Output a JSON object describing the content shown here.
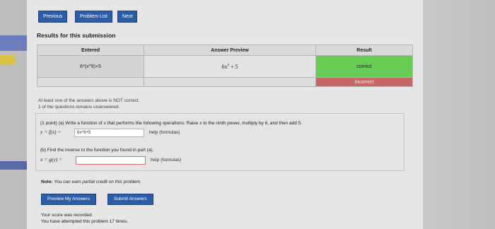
{
  "nav": {
    "previous": "Previous",
    "problem_list": "Problem List",
    "next": "Next"
  },
  "results": {
    "heading": "Results for this submission",
    "headers": [
      "Entered",
      "Answer Preview",
      "Result"
    ],
    "rows": [
      {
        "entered": "6*(x^9)+5",
        "preview_coef": "6x",
        "preview_exp": "9",
        "preview_tail": " + 5",
        "result": "correct"
      },
      {
        "entered": "",
        "preview": "",
        "result": "incorrect"
      }
    ],
    "warning_line1": "At least one of the answers above is NOT correct.",
    "warning_line2": "1 of the questions remains unanswered."
  },
  "problem": {
    "part_a_text_1": "(1 point) (a) Write a function of ",
    "part_a_var": "x",
    "part_a_text_2": " that performs the following operations: Raise ",
    "part_a_var2": "x",
    "part_a_text_3": " to the ninth power, multiply by 6, and then add 5.",
    "part_a_label": "y = f(x) =",
    "part_a_value": "6x^9+5",
    "help_a": "help (formulas)",
    "part_b_text": "(b) Find the inverse to the function you found in part (a).",
    "part_b_label": "x = g(y) =",
    "part_b_value": "",
    "help_b": "help (formulas)"
  },
  "note": {
    "bold": "Note:",
    "text": " You can earn partial credit on this problem."
  },
  "actions": {
    "preview": "Preview My Answers",
    "submit": "Submit Answers"
  },
  "status": {
    "line1": "Your score was recorded.",
    "line2": "You have attempted this problem 17 times."
  },
  "colors": {
    "button": "#2c5da8",
    "correct": "#66cc55",
    "incorrect": "#c76666"
  }
}
